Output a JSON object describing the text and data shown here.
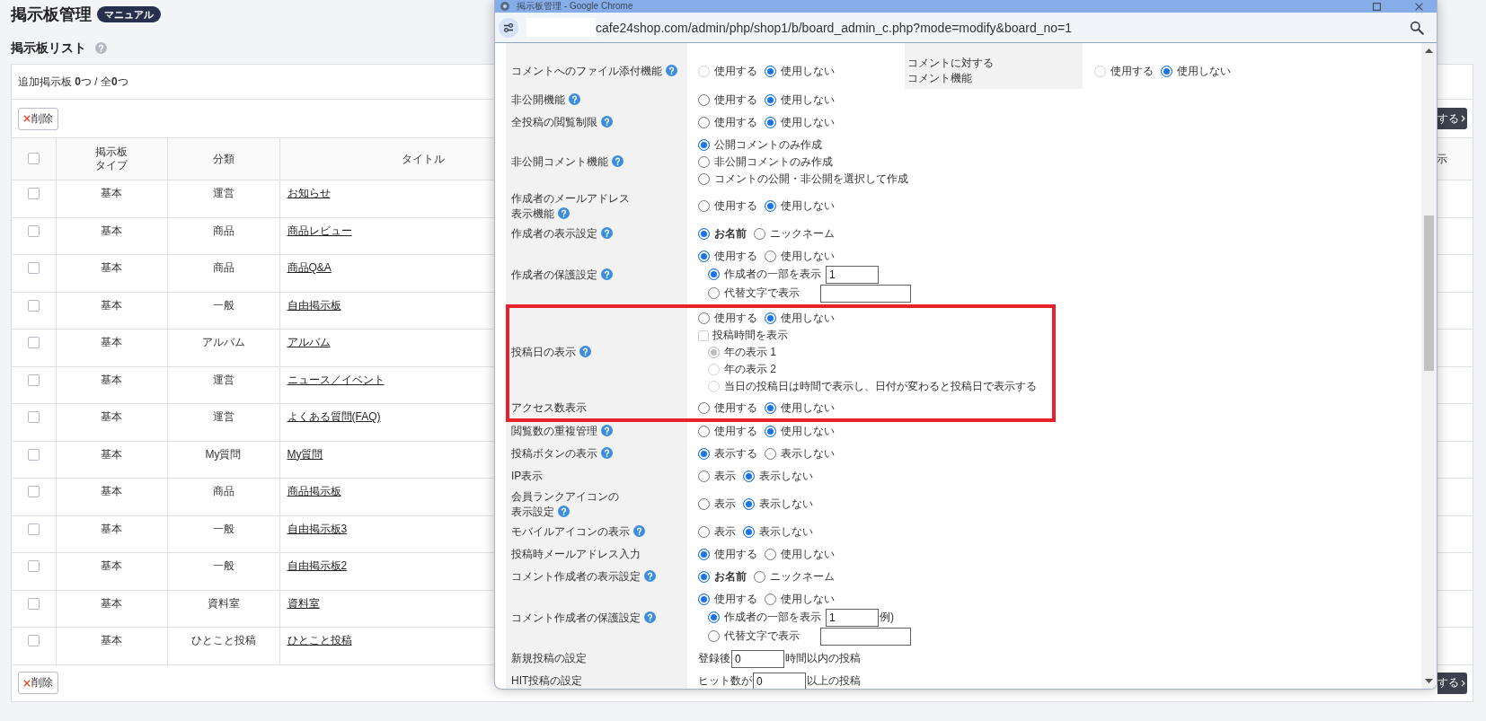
{
  "page": {
    "title": "掲示板管理",
    "manual_badge": "マニュアル",
    "list_title": "掲示板リスト"
  },
  "board_list": {
    "summary": "追加掲示板 **0**つ / 全**0**つ",
    "top_toolbar": {
      "delete_button": "削除",
      "action_button": "する"
    },
    "header_checkbox": {
      "checked": false
    },
    "columns": [
      "掲示板タイプ",
      "分類",
      "タイトル",
      "示"
    ],
    "rows": [
      {
        "checked": false,
        "type": "基本",
        "category": "運営",
        "title": "お知らせ"
      },
      {
        "checked": false,
        "type": "基本",
        "category": "商品",
        "title": "商品レビュー"
      },
      {
        "checked": false,
        "type": "基本",
        "category": "商品",
        "title": "商品Q&A"
      },
      {
        "checked": false,
        "type": "基本",
        "category": "一般",
        "title": "自由掲示板"
      },
      {
        "checked": false,
        "type": "基本",
        "category": "アルバム",
        "title": "アルバム"
      },
      {
        "checked": false,
        "type": "基本",
        "category": "運営",
        "title": "ニュース／イベント"
      },
      {
        "checked": false,
        "type": "基本",
        "category": "運営",
        "title": "よくある質問(FAQ)"
      },
      {
        "checked": false,
        "type": "基本",
        "category": "My質問",
        "title": "My質問"
      },
      {
        "checked": false,
        "type": "基本",
        "category": "商品",
        "title": "商品掲示板"
      },
      {
        "checked": false,
        "type": "基本",
        "category": "一般",
        "title": "自由掲示板3"
      },
      {
        "checked": false,
        "type": "基本",
        "category": "一般",
        "title": "自由掲示板2"
      },
      {
        "checked": false,
        "type": "基本",
        "category": "資料室",
        "title": "資料室"
      },
      {
        "checked": false,
        "type": "基本",
        "category": "ひとこと投稿",
        "title": "ひとこと投稿"
      }
    ],
    "bottom_toolbar": {
      "delete_button": "削除",
      "action_button": "する"
    }
  },
  "popup": {
    "window_title": "掲示板管理 - Google Chrome",
    "url": "cafe24shop.com/admin/php/shop1/b/board_admin_c.php?mode=modify&board_no=1",
    "settings": [
      {
        "label": "コメントへのファイル添付機能",
        "help": true,
        "highlighted": false,
        "lines": [
          {
            "items": [
              {
                "kind": "radio",
                "label": "使用する",
                "selected": false,
                "disabled": true,
                "bold": false
              },
              {
                "kind": "radio",
                "label": "使用しない",
                "selected": true,
                "disabled": false,
                "bold": false
              }
            ]
          }
        ],
        "paired_setting": {
          "label_lines": [
            "コメントに対する",
            "コメント機能"
          ],
          "help": false,
          "lines": [
            {
              "items": [
                {
                  "kind": "radio",
                  "label": "使用する",
                  "selected": false,
                  "disabled": true,
                  "bold": false
                },
                {
                  "kind": "radio",
                  "label": "使用しない",
                  "selected": true,
                  "disabled": false,
                  "bold": false
                }
              ]
            }
          ]
        }
      },
      {
        "label": "非公開機能",
        "help": true,
        "highlighted": false,
        "lines": [
          {
            "items": [
              {
                "kind": "radio",
                "label": "使用する",
                "selected": false,
                "disabled": false,
                "bold": false
              },
              {
                "kind": "radio",
                "label": "使用しない",
                "selected": true,
                "disabled": false,
                "bold": false
              }
            ]
          }
        ]
      },
      {
        "label": "全投稿の閲覧制限",
        "help": true,
        "highlighted": false,
        "lines": [
          {
            "items": [
              {
                "kind": "radio",
                "label": "使用する",
                "selected": false,
                "disabled": false,
                "bold": false
              },
              {
                "kind": "radio",
                "label": "使用しない",
                "selected": true,
                "disabled": false,
                "bold": false
              }
            ]
          }
        ]
      },
      {
        "label": "非公開コメント機能",
        "help": true,
        "highlighted": false,
        "lines": [
          {
            "items": [
              {
                "kind": "radio",
                "label": "公開コメントのみ作成",
                "selected": true,
                "disabled": false,
                "bold": false
              }
            ]
          },
          {
            "items": [
              {
                "kind": "radio",
                "label": "非公開コメントのみ作成",
                "selected": false,
                "disabled": false,
                "bold": false
              }
            ]
          },
          {
            "items": [
              {
                "kind": "radio",
                "label": "コメントの公開・非公開を選択して作成",
                "selected": false,
                "disabled": false,
                "bold": false
              }
            ]
          }
        ]
      },
      {
        "label_lines": [
          "作成者のメールアドレス",
          "表示機能"
        ],
        "help": true,
        "highlighted": false,
        "lines": [
          {
            "items": [
              {
                "kind": "radio",
                "label": "使用する",
                "selected": false,
                "disabled": false,
                "bold": false
              },
              {
                "kind": "radio",
                "label": "使用しない",
                "selected": true,
                "disabled": false,
                "bold": false
              }
            ]
          }
        ]
      },
      {
        "label": "作成者の表示設定",
        "help": true,
        "highlighted": false,
        "lines": [
          {
            "items": [
              {
                "kind": "radio",
                "label": "お名前",
                "selected": true,
                "disabled": false,
                "bold": true
              },
              {
                "kind": "radio",
                "label": "ニックネーム",
                "selected": false,
                "disabled": false,
                "bold": false
              }
            ]
          }
        ]
      },
      {
        "label": "作成者の保護設定",
        "help": true,
        "highlighted": false,
        "lines": [
          {
            "items": [
              {
                "kind": "radio",
                "label": "使用する",
                "selected": true,
                "disabled": false,
                "bold": false
              },
              {
                "kind": "radio",
                "label": "使用しない",
                "selected": false,
                "disabled": false,
                "bold": false
              }
            ],
            "children": [
              {
                "items": [
                  {
                    "kind": "radio",
                    "label": "作成者の一部を表示",
                    "selected": true,
                    "disabled": false,
                    "bold": false
                  },
                  {
                    "kind": "input",
                    "value": "1"
                  }
                ]
              },
              {
                "items": [
                  {
                    "kind": "radio",
                    "label": "代替文字で表示",
                    "selected": false,
                    "disabled": false,
                    "bold": false
                  },
                  {
                    "kind": "input"
                  }
                ]
              }
            ]
          }
        ]
      },
      {
        "label": "投稿日の表示",
        "help": true,
        "highlighted": true,
        "lines": [
          {
            "items": [
              {
                "kind": "radio",
                "label": "使用する",
                "selected": false,
                "disabled": false,
                "bold": false
              },
              {
                "kind": "radio",
                "label": "使用しない",
                "selected": true,
                "disabled": false,
                "bold": false
              }
            ]
          },
          {
            "items": [
              {
                "kind": "checkbox",
                "label": "投稿時間を表示",
                "checked": false,
                "disabled": true
              }
            ],
            "children": [
              {
                "items": [
                  {
                    "kind": "radio",
                    "label": "年の表示 1",
                    "selected": true,
                    "disabled": true,
                    "bold": false
                  }
                ]
              },
              {
                "items": [
                  {
                    "kind": "radio",
                    "label": "年の表示 2",
                    "selected": false,
                    "disabled": true,
                    "bold": false
                  }
                ]
              },
              {
                "items": [
                  {
                    "kind": "radio",
                    "label": "当日の投稿日は時間で表示し、日付が変わると投稿日で表示する",
                    "selected": false,
                    "disabled": true,
                    "bold": false
                  }
                ]
              }
            ]
          }
        ]
      },
      {
        "label": "アクセス数表示",
        "help": false,
        "highlighted": true,
        "lines": [
          {
            "items": [
              {
                "kind": "radio",
                "label": "使用する",
                "selected": false,
                "disabled": false,
                "bold": false
              },
              {
                "kind": "radio",
                "label": "使用しない",
                "selected": true,
                "disabled": false,
                "bold": false
              }
            ]
          }
        ]
      },
      {
        "label": "閲覧数の重複管理",
        "help": true,
        "highlighted": false,
        "lines": [
          {
            "items": [
              {
                "kind": "radio",
                "label": "使用する",
                "selected": false,
                "disabled": false,
                "bold": false
              },
              {
                "kind": "radio",
                "label": "使用しない",
                "selected": true,
                "disabled": false,
                "bold": false
              }
            ]
          }
        ]
      },
      {
        "label": "投稿ボタンの表示",
        "help": true,
        "highlighted": false,
        "lines": [
          {
            "items": [
              {
                "kind": "radio",
                "label": "表示する",
                "selected": true,
                "disabled": false,
                "bold": false
              },
              {
                "kind": "radio",
                "label": "表示しない",
                "selected": false,
                "disabled": false,
                "bold": false
              }
            ]
          }
        ]
      },
      {
        "label": "IP表示",
        "help": false,
        "highlighted": false,
        "lines": [
          {
            "items": [
              {
                "kind": "radio",
                "label": "表示",
                "selected": false,
                "disabled": false,
                "bold": false
              },
              {
                "kind": "radio",
                "label": "表示しない",
                "selected": true,
                "disabled": false,
                "bold": false
              }
            ]
          }
        ]
      },
      {
        "label_lines": [
          "会員ランクアイコンの",
          "表示設定"
        ],
        "help": true,
        "highlighted": false,
        "lines": [
          {
            "items": [
              {
                "kind": "radio",
                "label": "表示",
                "selected": false,
                "disabled": false,
                "bold": false
              },
              {
                "kind": "radio",
                "label": "表示しない",
                "selected": true,
                "disabled": false,
                "bold": false
              }
            ]
          }
        ]
      },
      {
        "label": "モバイルアイコンの表示",
        "help": true,
        "highlighted": false,
        "lines": [
          {
            "items": [
              {
                "kind": "radio",
                "label": "表示",
                "selected": false,
                "disabled": false,
                "bold": false
              },
              {
                "kind": "radio",
                "label": "表示しない",
                "selected": true,
                "disabled": false,
                "bold": false
              }
            ]
          }
        ]
      },
      {
        "label": "投稿時メールアドレス入力",
        "help": false,
        "highlighted": false,
        "lines": [
          {
            "items": [
              {
                "kind": "radio",
                "label": "使用する",
                "selected": true,
                "disabled": false,
                "bold": false
              },
              {
                "kind": "radio",
                "label": "使用しない",
                "selected": false,
                "disabled": false,
                "bold": false
              }
            ]
          }
        ]
      },
      {
        "label": "コメント作成者の表示設定",
        "help": true,
        "highlighted": false,
        "lines": [
          {
            "items": [
              {
                "kind": "radio",
                "label": "お名前",
                "selected": true,
                "disabled": false,
                "bold": true
              },
              {
                "kind": "radio",
                "label": "ニックネーム",
                "selected": false,
                "disabled": false,
                "bold": false
              }
            ]
          }
        ]
      },
      {
        "label": "コメント作成者の保護設定",
        "help": true,
        "highlighted": false,
        "lines": [
          {
            "items": [
              {
                "kind": "radio",
                "label": "使用する",
                "selected": true,
                "disabled": false,
                "bold": false
              },
              {
                "kind": "radio",
                "label": "使用しない",
                "selected": false,
                "disabled": false,
                "bold": false
              }
            ],
            "children": [
              {
                "items": [
                  {
                    "kind": "radio",
                    "label": "作成者の一部を表示",
                    "selected": true,
                    "disabled": false,
                    "bold": false
                  },
                  {
                    "kind": "input",
                    "value": "1"
                  },
                  {
                    "kind": "text",
                    "text": "例)"
                  }
                ]
              },
              {
                "items": [
                  {
                    "kind": "radio",
                    "label": "代替文字で表示",
                    "selected": false,
                    "disabled": false,
                    "bold": false
                  },
                  {
                    "kind": "input"
                  }
                ]
              }
            ]
          }
        ]
      },
      {
        "label": "新規投稿の設定",
        "help": false,
        "highlighted": false,
        "lines": [
          {
            "items": [
              {
                "kind": "text",
                "text": "登録後"
              },
              {
                "kind": "input",
                "value": "0"
              },
              {
                "kind": "text",
                "text": "時間以内の投稿"
              }
            ]
          }
        ]
      },
      {
        "label": "HIT投稿の設定",
        "help": false,
        "highlighted": false,
        "lines": [
          {
            "items": [
              {
                "kind": "text",
                "text": "ヒット数が"
              },
              {
                "kind": "input",
                "value": "0"
              },
              {
                "kind": "text",
                "text": "以上の投稿"
              }
            ]
          }
        ]
      }
    ]
  }
}
